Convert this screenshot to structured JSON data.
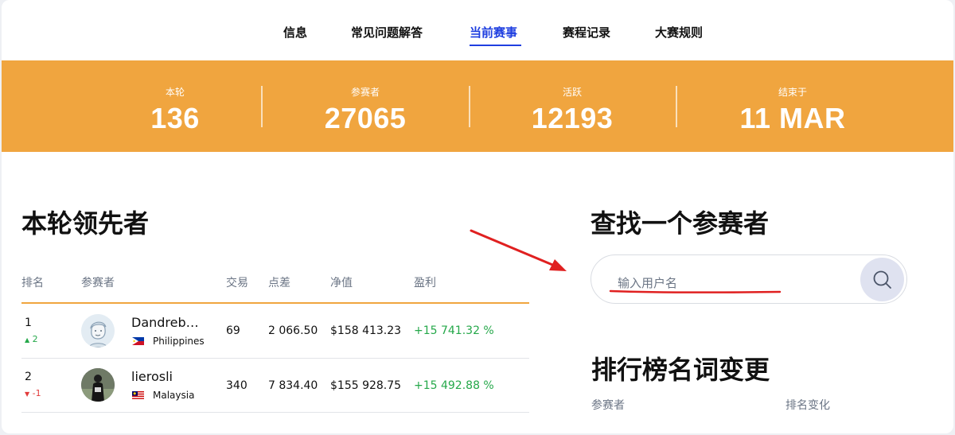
{
  "nav": {
    "items": [
      {
        "label": "信息"
      },
      {
        "label": "常见问题解答"
      },
      {
        "label": "当前赛事"
      },
      {
        "label": "赛程记录"
      },
      {
        "label": "大赛规则"
      }
    ],
    "active_index": 2,
    "active_color": "#1f3fe0"
  },
  "stats": {
    "round": {
      "label": "本轮",
      "value": "136"
    },
    "participants": {
      "label": "参赛者",
      "value": "27065"
    },
    "active": {
      "label": "活跃",
      "value": "12193"
    },
    "ends": {
      "label": "结束于",
      "value": "11 MAR"
    },
    "banner_color": "#f0a53f"
  },
  "leaders": {
    "title": "本轮领先者",
    "columns": {
      "rank": "排名",
      "participant": "参赛者",
      "trades": "交易",
      "points": "点差",
      "equity": "净值",
      "profit": "盈利"
    },
    "rows": [
      {
        "rank": "1",
        "change_arrow": "▲",
        "change": "2",
        "direction": "up",
        "name": "Dandreb…",
        "country": "Philippines",
        "flag": "philippines-flag",
        "trades": "69",
        "points": "2 066.50",
        "equity": "$158 413.23",
        "profit": "+15 741.32 %"
      },
      {
        "rank": "2",
        "change_arrow": "▼",
        "change": "-1",
        "direction": "down",
        "name": "lierosli",
        "country": "Malaysia",
        "flag": "malaysia-flag",
        "trades": "340",
        "points": "7 834.40",
        "equity": "$155 928.75",
        "profit": "+15 492.88 %"
      }
    ]
  },
  "search": {
    "title": "查找一个参赛者",
    "placeholder": "输入用户名",
    "icon": "search-icon"
  },
  "rank_changes": {
    "title": "排行榜名词变更",
    "columns": {
      "participant": "参赛者",
      "rank_change": "排名变化"
    }
  },
  "annotations": {
    "arrow_color": "#e02020",
    "underline_color": "#e02020"
  }
}
